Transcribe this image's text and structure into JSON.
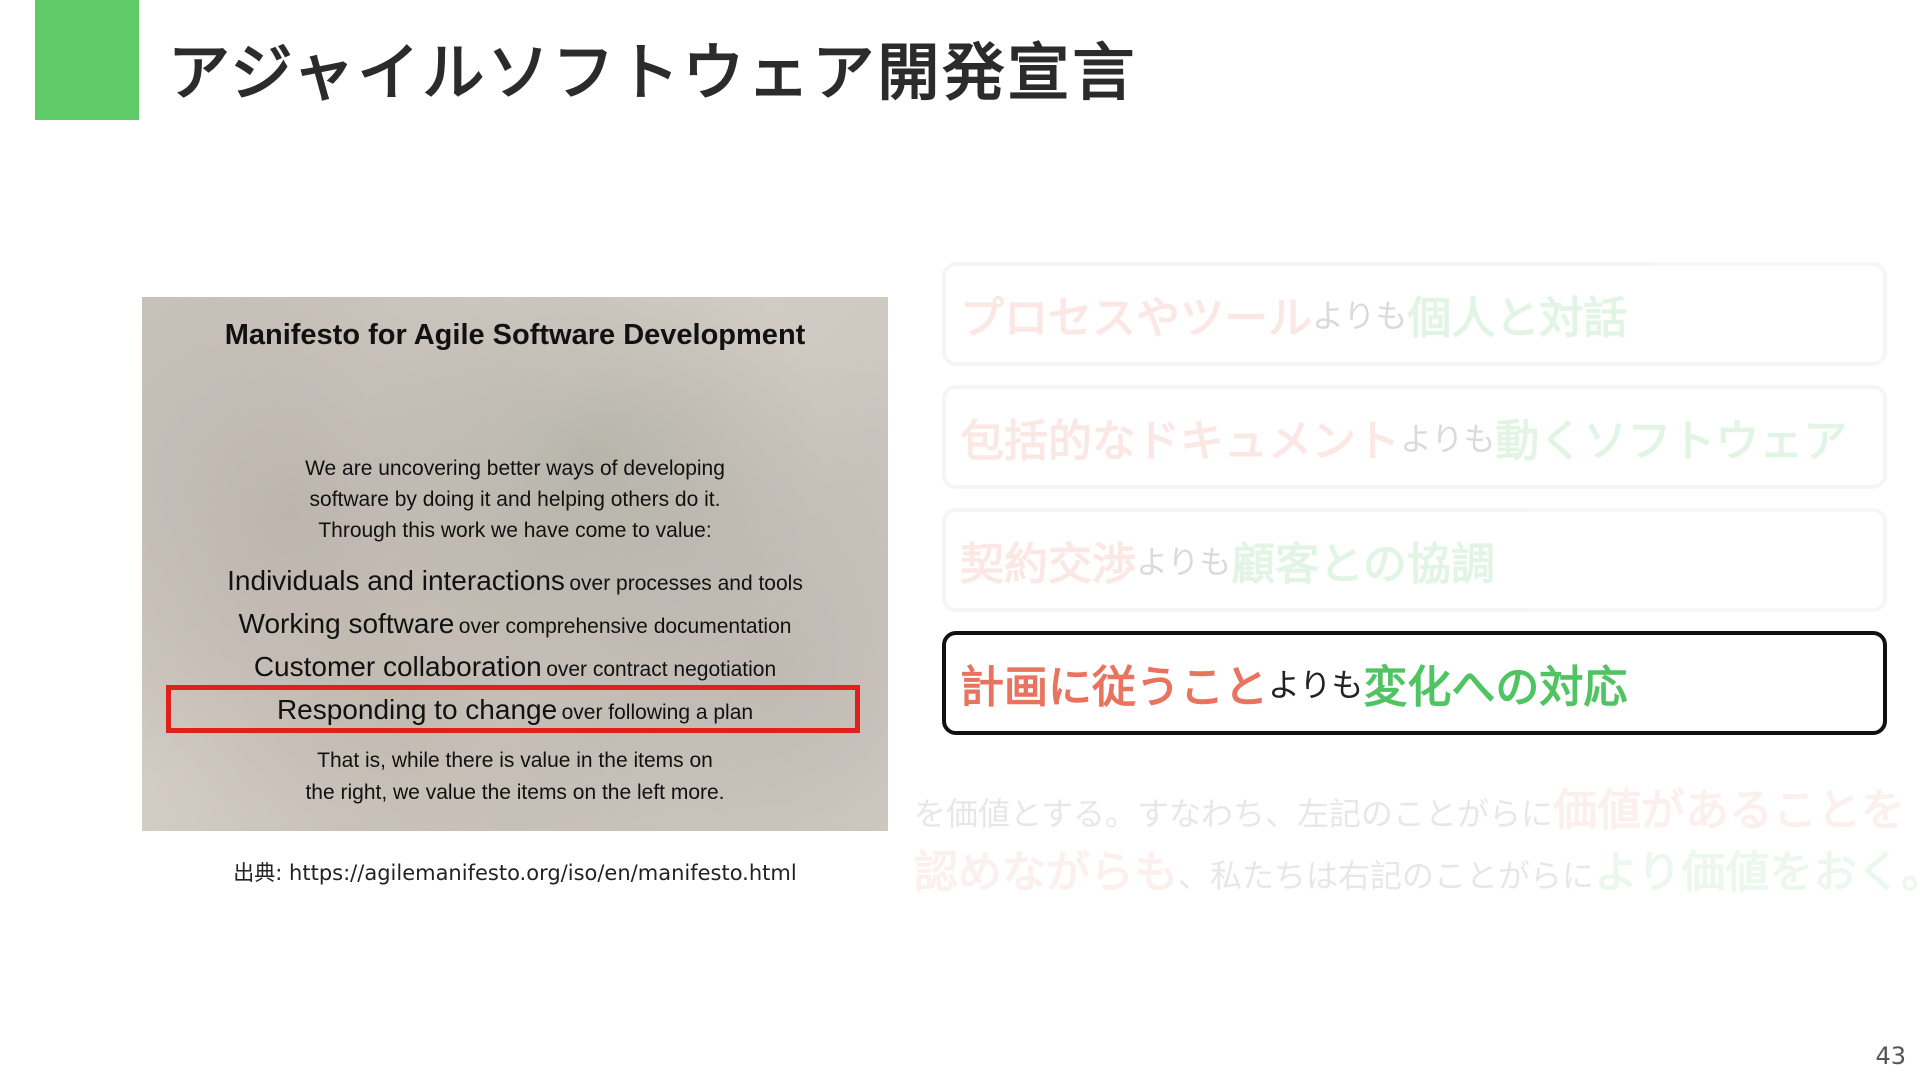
{
  "slide": {
    "title": "アジャイルソフトウェア開発宣言",
    "accent_color": "#5ecb68",
    "page_number": "43"
  },
  "manifesto": {
    "heading": "Manifesto for Agile Software Development",
    "intro": [
      "We are uncovering better ways of developing",
      "software by doing it and helping others do it.",
      "Through this work we have come to value:"
    ],
    "values": [
      {
        "left": "Individuals and interactions",
        "right": "over processes and tools"
      },
      {
        "left": "Working software",
        "right": "over comprehensive documentation"
      },
      {
        "left": "Customer collaboration",
        "right": "over contract negotiation"
      },
      {
        "left": "Responding to change",
        "right": "over following a plan"
      }
    ],
    "outro": [
      "That is, while there is value in the items on",
      "the right, we value the items on the left more."
    ],
    "highlight_color": "#e0201a"
  },
  "source": {
    "text": "出典: https://agilemanifesto.org/iso/en/manifesto.html"
  },
  "cards": [
    {
      "left": "プロセスやツール",
      "mid": "よりも",
      "right": "個人と対話",
      "state": "faded"
    },
    {
      "left": "包括的なドキュメント",
      "mid": "よりも",
      "right": "動くソフトウェア",
      "state": "faded"
    },
    {
      "left": "契約交渉",
      "mid": "よりも",
      "right": "顧客との協調",
      "state": "faded"
    },
    {
      "left": "計画に従うこと",
      "mid": "よりも",
      "right": "変化への対応",
      "state": "active"
    }
  ],
  "conclusion": {
    "line1_plain": "を価値とする。すなわち、左記のことがらに",
    "line1_red": "価値があることを",
    "line2_red": "認めながらも",
    "line2_plain": "、私たちは右記のことがらに",
    "line2_green": "より価値をおく。"
  },
  "colors": {
    "left_term": "#e8735f",
    "right_term": "#50c462"
  }
}
